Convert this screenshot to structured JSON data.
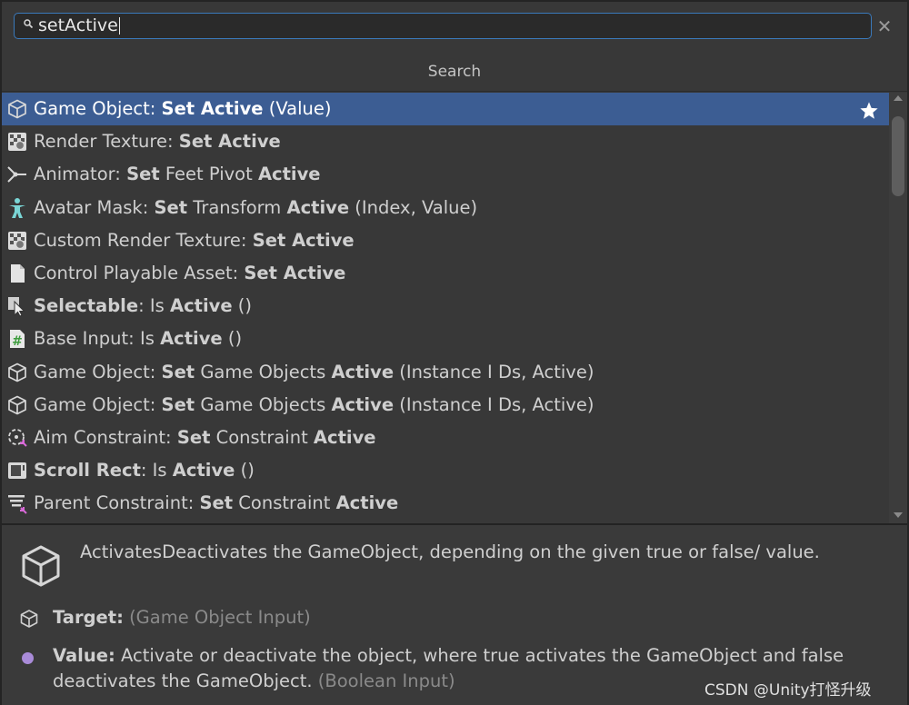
{
  "search": {
    "query": "setActive",
    "clear_symbol": "✕",
    "header": "Search"
  },
  "results": [
    {
      "parts": [
        {
          "t": "Game Object: ",
          "b": false
        },
        {
          "t": "Set Active",
          "b": true
        },
        {
          "t": " (Value)",
          "b": false
        }
      ],
      "icon": "cube-icon",
      "selected": true,
      "favorite": true
    },
    {
      "parts": [
        {
          "t": "Render Texture: ",
          "b": false
        },
        {
          "t": "Set Active",
          "b": true
        }
      ],
      "icon": "render-texture-icon"
    },
    {
      "parts": [
        {
          "t": "Animator: ",
          "b": false
        },
        {
          "t": "Set",
          "b": true
        },
        {
          "t": " Feet Pivot ",
          "b": false
        },
        {
          "t": "Active",
          "b": true
        }
      ],
      "icon": "animator-icon"
    },
    {
      "parts": [
        {
          "t": "Avatar Mask: ",
          "b": false
        },
        {
          "t": "Set",
          "b": true
        },
        {
          "t": " Transform ",
          "b": false
        },
        {
          "t": "Active",
          "b": true
        },
        {
          "t": " (Index, Value)",
          "b": false
        }
      ],
      "icon": "avatar-mask-icon"
    },
    {
      "parts": [
        {
          "t": "Custom Render Texture: ",
          "b": false
        },
        {
          "t": "Set Active",
          "b": true
        }
      ],
      "icon": "render-texture-icon"
    },
    {
      "parts": [
        {
          "t": "Control Playable Asset: ",
          "b": false
        },
        {
          "t": "Set Active",
          "b": true
        }
      ],
      "icon": "document-icon"
    },
    {
      "parts": [
        {
          "t": "Selectable",
          "b": true
        },
        {
          "t": ": Is ",
          "b": false
        },
        {
          "t": "Active",
          "b": true
        },
        {
          "t": " ()",
          "b": false
        }
      ],
      "icon": "selectable-icon"
    },
    {
      "parts": [
        {
          "t": "Base Input: Is ",
          "b": false
        },
        {
          "t": "Active",
          "b": true
        },
        {
          "t": " ()",
          "b": false
        }
      ],
      "icon": "csharp-script-icon"
    },
    {
      "parts": [
        {
          "t": "Game Object: ",
          "b": false
        },
        {
          "t": "Set",
          "b": true
        },
        {
          "t": " Game Objects ",
          "b": false
        },
        {
          "t": "Active",
          "b": true
        },
        {
          "t": " (Instance I Ds, Active)",
          "b": false
        }
      ],
      "icon": "cube-icon"
    },
    {
      "parts": [
        {
          "t": "Game Object: ",
          "b": false
        },
        {
          "t": "Set",
          "b": true
        },
        {
          "t": " Game Objects ",
          "b": false
        },
        {
          "t": "Active",
          "b": true
        },
        {
          "t": " (Instance I Ds, Active)",
          "b": false
        }
      ],
      "icon": "cube-icon"
    },
    {
      "parts": [
        {
          "t": "Aim Constraint: ",
          "b": false
        },
        {
          "t": "Set",
          "b": true
        },
        {
          "t": " Constraint ",
          "b": false
        },
        {
          "t": "Active",
          "b": true
        }
      ],
      "icon": "aim-constraint-icon"
    },
    {
      "parts": [
        {
          "t": "Scroll Rect",
          "b": true
        },
        {
          "t": ": Is ",
          "b": false
        },
        {
          "t": "Active",
          "b": true
        },
        {
          "t": " ()",
          "b": false
        }
      ],
      "icon": "scroll-rect-icon"
    },
    {
      "parts": [
        {
          "t": "Parent Constraint: ",
          "b": false
        },
        {
          "t": "Set",
          "b": true
        },
        {
          "t": " Constraint ",
          "b": false
        },
        {
          "t": "Active",
          "b": true
        }
      ],
      "icon": "parent-constraint-icon"
    }
  ],
  "details": {
    "summary": "ActivatesDeactivates the GameObject, depending on the given true or false/ value.",
    "params": [
      {
        "name": "Target:",
        "desc": "",
        "type": "(Game Object Input)",
        "icon": "cube-icon"
      },
      {
        "name": "Value:",
        "desc": " Activate or deactivate the object, where true activates the GameObject and false deactivates the GameObject. ",
        "type": "(Boolean Input)",
        "icon": "boolean-dot"
      }
    ]
  },
  "watermark": "CSDN @Unity打怪升级",
  "colors": {
    "selection": "#3c5d93",
    "focus_border": "#3a79bb",
    "boolean_port": "#a98bd8"
  }
}
